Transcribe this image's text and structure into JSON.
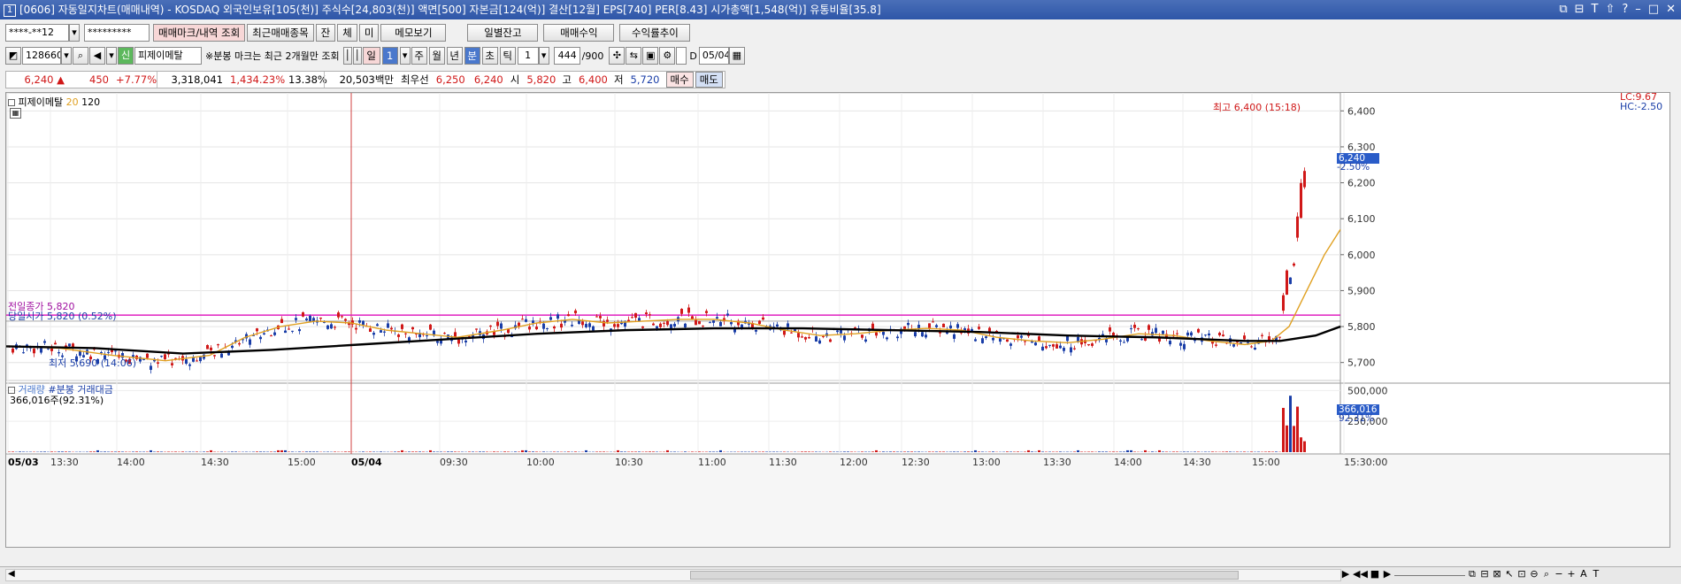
{
  "window": {
    "title": "[0606] 자동일지차트(매매내역) - KOSDAQ 외국인보유[105(천)] 주식수[24,803(천)] 액면[500] 자본금[124(억)] 결산[12월] EPS[740] PER[8.43] 시가총액[1,548(억)] 유통비율[35.8]",
    "number": "1"
  },
  "toolbar1": {
    "account": "****-**12",
    "password": "*********",
    "trade_mark_btn": "매매마크/내역 조회",
    "recent_btn": "최근매매종목",
    "jan": "잔",
    "che": "체",
    "mi": "미",
    "memo_btn": "메모보기",
    "daily_balance_btn": "일별잔고",
    "trade_profit_btn": "매매수익",
    "return_trend_btn": "수익률추이"
  },
  "toolbar2": {
    "code": "128660",
    "badge": "신",
    "name": "피제이메탈",
    "note": "※분봉 마크는 최근 2개월만 조회",
    "periods": [
      "일",
      "1",
      "주",
      "월",
      "년",
      "분",
      "초",
      "틱"
    ],
    "interval": "1",
    "count": "444",
    "count_total": "/900",
    "d_label": "D",
    "date": "05/04"
  },
  "quote": {
    "price": "6,240",
    "arrow": "▲",
    "change": "450",
    "rate": "+7.77%",
    "volume": "3,318,041",
    "vol_rate": "1,434.23%",
    "turnover": "13.38%",
    "amount": "20,503백만",
    "best_ask_label": "최우선",
    "ask": "6,250",
    "bid": "6,240",
    "open_label": "시",
    "open": "5,820",
    "high_label": "고",
    "high": "6,400",
    "low_label": "저",
    "low": "5,720",
    "buy_btn": "매수",
    "sell_btn": "매도"
  },
  "chart": {
    "legend_name": "피제이메탈",
    "ma1": "20",
    "ma2": "120",
    "lc": "LC:9.67",
    "hc": "HC:-2.50",
    "price_ticks": [
      "6,400",
      "6,300",
      "6,200",
      "6,100",
      "6,000",
      "5,900",
      "5,800",
      "5,700"
    ],
    "current_price": "6,240",
    "current_rate": "-2.50%",
    "high_note": "최고 6,400 (15:18)",
    "low_note": "최저 5,690 (14:06)",
    "prev_close_note": "당일시가 5,820 (0.52%)",
    "prev_close_note2": "전일종가 5,820",
    "vol_legend1": "거래량",
    "vol_legend2": "#분봉 거래대금",
    "vol_value": "366,016주(92.31%)",
    "vol_ticks": [
      "500,000",
      "250,000"
    ],
    "vol_current": "366,016",
    "vol_rate": "92.31%",
    "time_labels": [
      "05/03",
      "13:30",
      "14:00",
      "14:30",
      "15:00",
      "05/04",
      "09:30",
      "10:00",
      "10:30",
      "11:00",
      "11:30",
      "12:00",
      "12:30",
      "13:00",
      "13:30",
      "14:00",
      "14:30",
      "15:00",
      "15:30:00"
    ],
    "colors": {
      "up": "#d01818",
      "down": "#1a3ea8",
      "ma20": "#e0a020",
      "ma120": "#000000",
      "prev_line": "#e020c0"
    }
  },
  "chart_data": {
    "type": "candlestick",
    "y_range": [
      5650,
      6450
    ],
    "ma20_points": [
      [
        0,
        5745
      ],
      [
        60,
        5740
      ],
      [
        120,
        5720
      ],
      [
        180,
        5705
      ],
      [
        230,
        5720
      ],
      [
        270,
        5770
      ],
      [
        310,
        5800
      ],
      [
        350,
        5815
      ],
      [
        390,
        5810
      ],
      [
        430,
        5790
      ],
      [
        470,
        5780
      ],
      [
        510,
        5770
      ],
      [
        560,
        5790
      ],
      [
        600,
        5810
      ],
      [
        640,
        5820
      ],
      [
        680,
        5810
      ],
      [
        720,
        5815
      ],
      [
        760,
        5820
      ],
      [
        800,
        5820
      ],
      [
        840,
        5810
      ],
      [
        880,
        5790
      ],
      [
        920,
        5775
      ],
      [
        960,
        5780
      ],
      [
        1000,
        5790
      ],
      [
        1040,
        5795
      ],
      [
        1080,
        5790
      ],
      [
        1120,
        5770
      ],
      [
        1160,
        5760
      ],
      [
        1200,
        5755
      ],
      [
        1240,
        5765
      ],
      [
        1280,
        5780
      ],
      [
        1320,
        5775
      ],
      [
        1360,
        5760
      ],
      [
        1400,
        5750
      ],
      [
        1430,
        5760
      ],
      [
        1450,
        5800
      ],
      [
        1470,
        5900
      ],
      [
        1490,
        6000
      ],
      [
        1508,
        6070
      ]
    ],
    "ma120_points": [
      [
        0,
        5745
      ],
      [
        100,
        5740
      ],
      [
        200,
        5725
      ],
      [
        300,
        5735
      ],
      [
        400,
        5750
      ],
      [
        500,
        5765
      ],
      [
        600,
        5780
      ],
      [
        700,
        5790
      ],
      [
        800,
        5795
      ],
      [
        900,
        5795
      ],
      [
        1000,
        5790
      ],
      [
        1100,
        5785
      ],
      [
        1200,
        5775
      ],
      [
        1300,
        5770
      ],
      [
        1400,
        5760
      ],
      [
        1440,
        5760
      ],
      [
        1480,
        5775
      ],
      [
        1508,
        5800
      ]
    ]
  }
}
